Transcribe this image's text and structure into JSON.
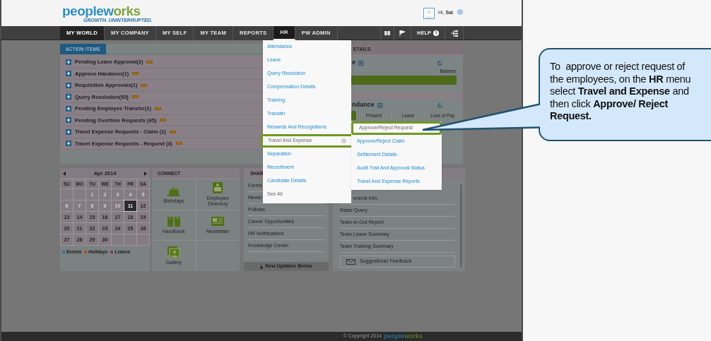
{
  "header": {
    "logo": "peopleworks",
    "tagline": "GROWTH. UNINTERRUPTED.",
    "greeting": "Hi, **Sai**"
  },
  "nav": {
    "items": [
      {
        "label": "MY WORLD",
        "selected": true,
        "open": false
      },
      {
        "label": "MY COMPANY",
        "selected": false,
        "open": false
      },
      {
        "label": "MY SELF",
        "selected": false,
        "open": false
      },
      {
        "label": "MY TEAM",
        "selected": false,
        "open": false
      },
      {
        "label": "REPORTS",
        "selected": false,
        "open": false
      },
      {
        "label": "HR",
        "selected": false,
        "open": true
      },
      {
        "label": "PW ADMIN",
        "selected": false,
        "open": false
      }
    ],
    "help": "HELP"
  },
  "action_items": {
    "tab": "ACTION ITEMS",
    "rows": [
      {
        "label": "Pending Leave Approval(2)",
        "new": true
      },
      {
        "label": "Approve Handover(1)",
        "new": true
      },
      {
        "label": "Requisition Approvals(1)",
        "new": true
      },
      {
        "label": "Query Resolution(53)",
        "new": true
      },
      {
        "label": "Pending Employee Transfer(1)",
        "new": true
      },
      {
        "label": "Pending Overtime Requests (45)",
        "new": true
      },
      {
        "label": "Travel Expense Requests - Claim (1)",
        "new": true
      },
      {
        "label": "Travel Expense Requests - Request (3)",
        "new": true
      }
    ]
  },
  "details": {
    "title": "ETAILS",
    "leave": {
      "title": "e",
      "balance_label": "Balance"
    },
    "attendance": {
      "title": "ndance",
      "columns": [
        "Present",
        "Leave",
        "Loss of Pay"
      ]
    }
  },
  "calendar": {
    "month": "Apr 2014",
    "weekdays": [
      "SU",
      "MO",
      "TU",
      "WE",
      "TH",
      "FR",
      "SA"
    ],
    "weeks": [
      [
        {
          "kind": "blank"
        },
        {
          "kind": "blank"
        },
        {
          "kind": "day",
          "day": "1",
          "faded": true,
          "selected": false
        },
        {
          "kind": "day",
          "day": "2",
          "faded": true,
          "selected": false
        },
        {
          "kind": "day",
          "day": "3",
          "faded": true,
          "selected": false
        },
        {
          "kind": "day",
          "day": "4",
          "faded": true,
          "selected": false
        },
        {
          "kind": "day",
          "day": "5",
          "faded": true,
          "selected": false
        }
      ],
      [
        {
          "kind": "day",
          "day": "6",
          "faded": true,
          "selected": false
        },
        {
          "kind": "day",
          "day": "7",
          "faded": true,
          "selected": false
        },
        {
          "kind": "day",
          "day": "8",
          "faded": true,
          "selected": false
        },
        {
          "kind": "day",
          "day": "9",
          "faded": true,
          "selected": false
        },
        {
          "kind": "day",
          "day": "10",
          "faded": true,
          "selected": false
        },
        {
          "kind": "day",
          "day": "11",
          "faded": false,
          "selected": true
        },
        {
          "kind": "day",
          "day": "12",
          "faded": false,
          "selected": false
        }
      ],
      [
        {
          "kind": "day",
          "day": "13",
          "faded": false,
          "selected": false
        },
        {
          "kind": "day",
          "day": "14",
          "faded": false,
          "selected": false
        },
        {
          "kind": "day",
          "day": "15",
          "faded": false,
          "selected": false
        },
        {
          "kind": "day",
          "day": "16",
          "faded": false,
          "selected": false
        },
        {
          "kind": "day",
          "day": "17",
          "faded": false,
          "selected": false
        },
        {
          "kind": "day",
          "day": "18",
          "faded": false,
          "selected": false
        },
        {
          "kind": "day",
          "day": "19",
          "faded": false,
          "selected": false
        }
      ],
      [
        {
          "kind": "day",
          "day": "20",
          "faded": false,
          "selected": false
        },
        {
          "kind": "day",
          "day": "21",
          "faded": false,
          "selected": false
        },
        {
          "kind": "day",
          "day": "22",
          "faded": false,
          "selected": false
        },
        {
          "kind": "day",
          "day": "23",
          "faded": false,
          "selected": false
        },
        {
          "kind": "day",
          "day": "24",
          "faded": false,
          "selected": false
        },
        {
          "kind": "day",
          "day": "25",
          "faded": false,
          "selected": false
        },
        {
          "kind": "day",
          "day": "26",
          "faded": false,
          "selected": false
        }
      ],
      [
        {
          "kind": "day",
          "day": "27",
          "faded": false,
          "selected": false
        },
        {
          "kind": "day",
          "day": "28",
          "faded": false,
          "selected": false
        },
        {
          "kind": "day",
          "day": "29",
          "faded": false,
          "selected": false
        },
        {
          "kind": "day",
          "day": "30",
          "faded": false,
          "selected": false
        },
        {
          "kind": "blank"
        },
        {
          "kind": "blank"
        },
        {
          "kind": "blank"
        }
      ]
    ],
    "legend": [
      {
        "label": "Events",
        "color": "#2a78a8"
      },
      {
        "label": "Holidays",
        "color": "#a8501e"
      },
      {
        "label": "Leaves",
        "color": "#9a2a70"
      }
    ]
  },
  "connect": {
    "title": "CONNECT",
    "tiles": [
      {
        "label": "Birthdays",
        "kind": "cake"
      },
      {
        "label": "Employee Directory",
        "kind": "directory"
      },
      {
        "label": "Handbook",
        "kind": "book"
      },
      {
        "label": "Newsletter",
        "kind": "newspaper"
      },
      {
        "label": "Gallery",
        "kind": "photo"
      }
    ]
  },
  "shared": {
    "title": "SHAR",
    "items": [
      "Forms",
      "Newsl",
      "Policies",
      "Career Opportunities",
      "HR Notifications",
      "Knowledge Center"
    ],
    "footer": "New Updates Below"
  },
  "links": {
    "items": [
      "eneral Info.",
      "Raise Query",
      "Team In-Out Report",
      "Team Leave Summary",
      "Team Training Summary"
    ],
    "feedback": "Suggestions/ Feedback"
  },
  "hr_menu": {
    "items": [
      {
        "label": "Attendance",
        "kind": "link",
        "selected": false
      },
      {
        "label": "Leave",
        "kind": "link",
        "selected": false
      },
      {
        "label": "Query Resolution",
        "kind": "link",
        "selected": false
      },
      {
        "label": "Compensation Details",
        "kind": "link",
        "selected": false
      },
      {
        "label": "Training",
        "kind": "link",
        "selected": false
      },
      {
        "label": "Transfer",
        "kind": "link",
        "selected": false
      },
      {
        "label": "Rewards And Recognitions",
        "kind": "link",
        "selected": false
      },
      {
        "label": "Travel And Expense",
        "kind": "submenu",
        "selected": true
      },
      {
        "label": "Separation",
        "kind": "link",
        "selected": false
      },
      {
        "label": "Recruitment",
        "kind": "link",
        "selected": false
      },
      {
        "label": "Candidate Details",
        "kind": "link",
        "selected": false
      },
      {
        "label": "See All",
        "kind": "more",
        "selected": false
      }
    ],
    "submenu": [
      {
        "label": "Approve/Reject Request",
        "selected": true
      },
      {
        "label": "Approve/Reject Claim",
        "selected": false
      },
      {
        "label": "Settlement Details",
        "selected": false
      },
      {
        "label": "Audit Trail And Approval Status",
        "selected": false
      },
      {
        "label": "Travel And Expense Reports",
        "selected": false
      }
    ]
  },
  "footer": {
    "copyright": "© Copyright 2014",
    "logo": "peopleworks"
  },
  "callout": {
    "text": "To  approve or reject request of the employees, on the **HR** menu select **Travel and Expense** and then click **Approve/ Reject Request.**"
  }
}
